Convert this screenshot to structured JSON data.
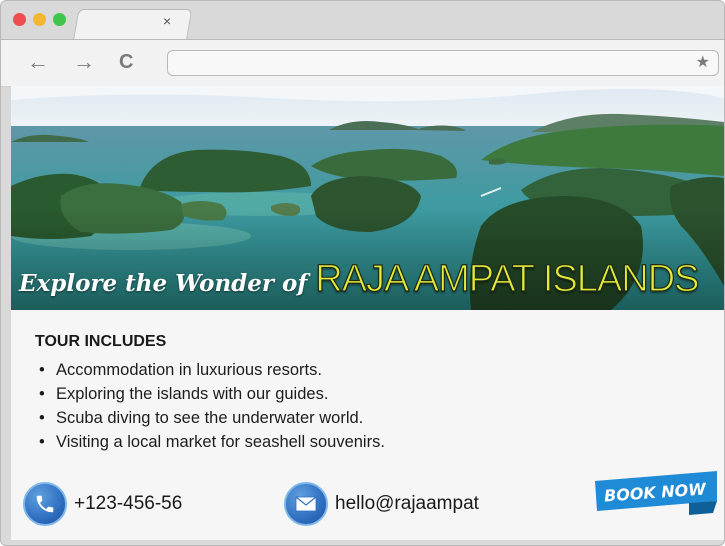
{
  "browser": {
    "tab_close": "×",
    "nav": {
      "back": "←",
      "forward": "→",
      "reload": "C"
    },
    "address_value": "",
    "star": "★"
  },
  "hero": {
    "script_text": "Explore the Wonder of",
    "title": "RAJA AMPAT ISLANDS"
  },
  "tour": {
    "heading": "TOUR INCLUDES",
    "bullet": "•",
    "items": [
      "Accommodation in luxurious resorts.",
      "Exploring the islands with our guides.",
      "Scuba diving to see the underwater world.",
      "Visiting a local market for seashell souvenirs."
    ]
  },
  "contact": {
    "phone": "+123-456-56",
    "email": "hello@rajaampat"
  },
  "cta": {
    "book_label": "BOOK NOW"
  },
  "colors": {
    "title_yellow": "#e3ea3a",
    "badge_blue": "#1f8ad6",
    "icon_blue": "#2f6fc0"
  }
}
